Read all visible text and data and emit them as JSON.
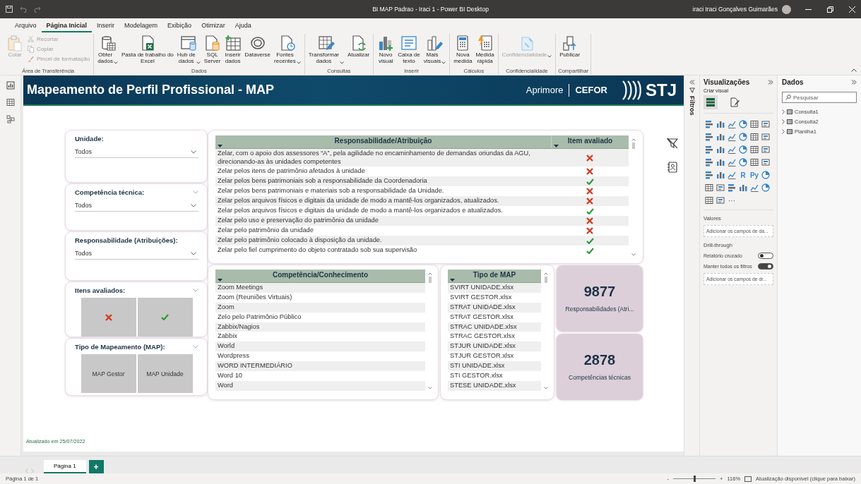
{
  "window": {
    "title": "BI MAP Padrao - Iraci 1 - Power BI Desktop",
    "user": "iraci Iraci Gonçalves Guimarães"
  },
  "menu_tabs": [
    {
      "label": "Arquivo",
      "selected": false
    },
    {
      "label": "Página Inicial",
      "selected": true
    },
    {
      "label": "Inserir",
      "selected": false
    },
    {
      "label": "Modelagem",
      "selected": false
    },
    {
      "label": "Exibição",
      "selected": false
    },
    {
      "label": "Otimizar",
      "selected": false
    },
    {
      "label": "Ajuda",
      "selected": false
    }
  ],
  "ribbon_groups": [
    {
      "label": "Área de Transferência",
      "buttons": [
        {
          "kind": "large",
          "label": "Colar",
          "disabled": true,
          "dropdown": false
        },
        {
          "kind": "small",
          "label": "Recortar",
          "disabled": true,
          "dropdown": false
        },
        {
          "kind": "small",
          "label": "Copiar",
          "disabled": true,
          "dropdown": false
        },
        {
          "kind": "small",
          "label": "Pincel de formatação",
          "disabled": true,
          "dropdown": false
        }
      ]
    },
    {
      "label": "Dados",
      "buttons": [
        {
          "kind": "large",
          "label": "Obter\ndados",
          "disabled": false,
          "dropdown": true
        },
        {
          "kind": "large",
          "label": "Pasta de trabalho do\nExcel",
          "disabled": false,
          "dropdown": false
        },
        {
          "kind": "large",
          "label": "Hub de\ndados",
          "disabled": false,
          "dropdown": true
        },
        {
          "kind": "large",
          "label": "SQL\nServer",
          "disabled": false,
          "dropdown": false
        },
        {
          "kind": "large",
          "label": "Inserir\ndados",
          "disabled": false,
          "dropdown": false
        },
        {
          "kind": "large",
          "label": "Dataverse",
          "disabled": false,
          "dropdown": false
        },
        {
          "kind": "large",
          "label": "Fontes\nrecentes",
          "disabled": false,
          "dropdown": true
        }
      ]
    },
    {
      "label": "Consultas",
      "buttons": [
        {
          "kind": "large",
          "label": "Transformar\ndados",
          "disabled": false,
          "dropdown": true
        },
        {
          "kind": "large",
          "label": "Atualizar",
          "disabled": false,
          "dropdown": false
        }
      ]
    },
    {
      "label": "Inserir",
      "buttons": [
        {
          "kind": "large",
          "label": "Novo\nvisual",
          "disabled": false,
          "dropdown": false
        },
        {
          "kind": "large",
          "label": "Caixa de\ntexto",
          "disabled": false,
          "dropdown": false
        },
        {
          "kind": "large",
          "label": "Mais\nvisuais",
          "disabled": false,
          "dropdown": true
        }
      ]
    },
    {
      "label": "Cálculos",
      "buttons": [
        {
          "kind": "large",
          "label": "Nova\nmedida",
          "disabled": false,
          "dropdown": false
        },
        {
          "kind": "large",
          "label": "Medida\nrápida",
          "disabled": false,
          "dropdown": false
        }
      ]
    },
    {
      "label": "Confidencialidade",
      "buttons": [
        {
          "kind": "large",
          "label": "Confidencialidade",
          "disabled": true,
          "dropdown": true
        }
      ]
    },
    {
      "label": "Compartilhar",
      "buttons": [
        {
          "kind": "large",
          "label": "Publicar",
          "disabled": false,
          "dropdown": false
        }
      ]
    }
  ],
  "report": {
    "title": "Mapeamento de Perfil Profissional - MAP",
    "brand": "Aprimore",
    "brand_unit": "CEFOR",
    "logo": "STJ",
    "updated": "Atualizado em 25/07/2022",
    "slicers": [
      {
        "kind": "dropdown",
        "title": "Unidade:",
        "value": "Todos",
        "header_chevron": false
      },
      {
        "kind": "dropdown",
        "title": "Competência técnica:",
        "value": "Todos",
        "header_chevron": true
      },
      {
        "kind": "dropdown",
        "title": "Responsabilidade (Atribuições):",
        "value": "Todos",
        "header_chevron": false
      },
      {
        "kind": "tiles",
        "title": "Itens avaliados:",
        "header_chevron": true,
        "tiles": [
          {
            "kind": "cross"
          },
          {
            "kind": "check"
          }
        ]
      },
      {
        "kind": "tiles",
        "title": "Tipo de Mapeamento (MAP):",
        "header_chevron": true,
        "tiles": [
          {
            "kind": "text",
            "label": "MAP Gestor"
          },
          {
            "kind": "text",
            "label": "MAP Unidade"
          }
        ]
      }
    ],
    "table": {
      "columns": [
        "Responsabilidade/Atribuição",
        "Item avaliado"
      ],
      "rows": [
        {
          "text": "Zelar, com o apoio dos assessores “A”, pela agilidade no encaminhamento de demandas oriundas da AGU, direcionando-as às unidades competentes",
          "evaluated": false
        },
        {
          "text": "Zelar pelos itens de patrimônio afetados à unidade",
          "evaluated": false
        },
        {
          "text": "Zelar pelos bens patrimoniais sob a responsabilidade da Coordenadoria",
          "evaluated": true
        },
        {
          "text": "Zelar pelos bens patrimoniais e materiais sob a responsabilidade da Unidade.",
          "evaluated": false
        },
        {
          "text": "Zelar pelos arquivos físicos e digitais da unidade de modo a mantê-los organizados, atualizados.",
          "evaluated": false
        },
        {
          "text": "Zelar pelos arquivos físicos e digitais da unidade de modo a mantê-los organizados e atualizados.",
          "evaluated": true
        },
        {
          "text": "Zelar pelo uso e preservação do patrimônio da unidade",
          "evaluated": false
        },
        {
          "text": "Zelar pelo patrimônio da unidade",
          "evaluated": false
        },
        {
          "text": "Zelar pelo patrimônio colocado à disposição da unidade.",
          "evaluated": true
        },
        {
          "text": "Zelar pelo fiel cumprimento do objeto contratado sob sua supervisão",
          "evaluated": true
        }
      ]
    },
    "lists": [
      {
        "column": "Competência/Conhecimento",
        "items": [
          "Zoom Meetings",
          "Zoom (Reuniões Virtuais)",
          "Zoom",
          "Zelo pelo Patrimônio Público",
          "Zabbix/Nagios",
          "Zabbix",
          "World",
          "Wordpress",
          "WORD INTERMEDIÁRIO",
          "Word 10",
          "Word"
        ]
      },
      {
        "column": "Tipo de MAP",
        "items": [
          "SVIRT UNIDADE.xlsx",
          "SVIRT GESTOR.xlsx",
          "STRAT UNIDADE.xlsx",
          "STRAT GESTOR.xlsx",
          "STRAC UNIDADE.xlsx",
          "STRAC GESTOR.xlsx",
          "STJUR UNIDADE.xlsx",
          "STJUR GESTOR.xlsx",
          "STI UNIDADE.xlsx",
          "STI GESTOR.xlsx",
          "STESE UNIDADE.xlsx"
        ]
      }
    ],
    "cards": [
      {
        "value": "9877",
        "label": "Responsabilidades (Atri..."
      },
      {
        "value": "2878",
        "label": "Competências técnicas"
      }
    ]
  },
  "filters_pane": {
    "label": "Filtros"
  },
  "visualizations": {
    "title": "Visualizações",
    "subtitle": "Criar visual",
    "tabs": [
      {
        "selected": true
      },
      {
        "selected": false
      }
    ],
    "text_icons": [
      "R",
      "Py"
    ],
    "more": "···",
    "values_label": "Valores",
    "values_placeholder": "Adicionar os campos de da...",
    "drill_title": "Drill-through",
    "toggles": [
      {
        "label": "Relatório cruzado",
        "on": false
      },
      {
        "label": "Manter todos os filtros",
        "on": true
      }
    ],
    "drill_placeholder": "Adicionar os campos de dr..."
  },
  "data_pane": {
    "title": "Dados",
    "search_placeholder": "Pesquisar",
    "tables": [
      {
        "name": "Consulta1"
      },
      {
        "name": "Consulta2"
      },
      {
        "name": "Planilha1"
      }
    ]
  },
  "page_tabs": [
    {
      "label": "Página 1",
      "selected": true
    }
  ],
  "add_page": "+",
  "status_bar": {
    "page": "Página 1 de 1",
    "level": 0.5,
    "zoom_minus": "-",
    "zoom_plus": "+",
    "zoom": "116%",
    "update": "Atualização disponível (clique para baixar)"
  }
}
